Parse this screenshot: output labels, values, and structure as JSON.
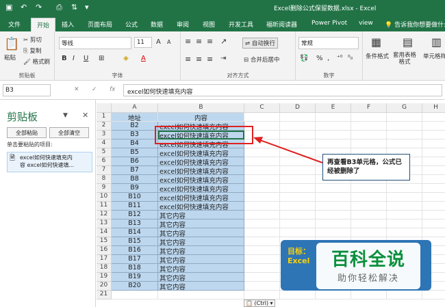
{
  "window": {
    "title": "Excel删除公式保留数据.xlsx - Excel"
  },
  "tabs": [
    {
      "label": "文件"
    },
    {
      "label": "开始"
    },
    {
      "label": "插入"
    },
    {
      "label": "页面布局"
    },
    {
      "label": "公式"
    },
    {
      "label": "数据"
    },
    {
      "label": "审阅"
    },
    {
      "label": "视图"
    },
    {
      "label": "开发工具"
    },
    {
      "label": "福昕阅读器"
    },
    {
      "label": "Power Pivot"
    },
    {
      "label": "view"
    },
    {
      "label": "告诉我你想要做什么..."
    }
  ],
  "ribbon": {
    "clipboard": {
      "paste": "粘贴",
      "cut": "剪切",
      "copy": "复制",
      "format_painter": "格式刷",
      "group": "剪贴板"
    },
    "font": {
      "name": "等线",
      "size": "11",
      "group": "字体",
      "grow": "A",
      "shrink": "A",
      "bold": "B",
      "italic": "I",
      "underline": "U",
      "font_color": "A"
    },
    "alignment": {
      "wrap": "自动换行",
      "merge": "合并后居中",
      "group": "对齐方式"
    },
    "number": {
      "format": "常规",
      "percent": "%",
      "comma": ",",
      "group": "数字"
    },
    "styles": {
      "conditional": "条件格式",
      "table": "套用表格格式",
      "cell": "单元格样"
    }
  },
  "formula_bar": {
    "name_box": "B3",
    "cancel": "✕",
    "confirm": "✓",
    "fx": "fx",
    "content": "excel如何快速填充内容"
  },
  "clipboard_pane": {
    "title": "剪贴板",
    "paste_all": "全部粘贴",
    "clear_all": "全部清空",
    "hint": "单击要粘贴的项目:",
    "item_line1": "excel如何快速填充内",
    "item_line2": "容 excel如何快速填..."
  },
  "sheet": {
    "columns": [
      "A",
      "B",
      "C",
      "D",
      "E",
      "F",
      "G",
      "H"
    ],
    "rows": [
      [
        "1",
        "地址",
        "内容"
      ],
      [
        "2",
        "B2",
        "excel如何快速填充内容"
      ],
      [
        "3",
        "B3",
        "excel如何快速填充内容"
      ],
      [
        "4",
        "B4",
        "excel如何快速填充内容"
      ],
      [
        "5",
        "B5",
        "excel如何快速填充内容"
      ],
      [
        "6",
        "B6",
        "excel如何快速填充内容"
      ],
      [
        "7",
        "B7",
        "excel如何快速填充内容"
      ],
      [
        "8",
        "B8",
        "excel如何快速填充内容"
      ],
      [
        "9",
        "B9",
        "excel如何快速填充内容"
      ],
      [
        "10",
        "B10",
        "excel如何快速填充内容"
      ],
      [
        "11",
        "B11",
        "excel如何快速填充内容"
      ],
      [
        "12",
        "B12",
        "其它内容"
      ],
      [
        "13",
        "B13",
        "其它内容"
      ],
      [
        "14",
        "B14",
        "其它内容"
      ],
      [
        "15",
        "B15",
        "其它内容"
      ],
      [
        "16",
        "B16",
        "其它内容"
      ],
      [
        "17",
        "B17",
        "其它内容"
      ],
      [
        "18",
        "B18",
        "其它内容"
      ],
      [
        "19",
        "B19",
        "其它内容"
      ],
      [
        "20",
        "B20",
        "其它内容"
      ],
      [
        "21",
        "",
        ""
      ]
    ],
    "paste_options": "(Ctrl)"
  },
  "annotation": {
    "callout": "再查看B3单元格，公式已经被删除了"
  },
  "banner": {
    "line1": "目标：",
    "line2": "Excel"
  },
  "watermark": {
    "title": "百科全说",
    "subtitle": "助你轻松解决"
  },
  "colors": {
    "excel_green": "#217346",
    "selection": "#bdd7ee",
    "callout_border": "#1f4e79",
    "highlight_red": "#e02020"
  }
}
